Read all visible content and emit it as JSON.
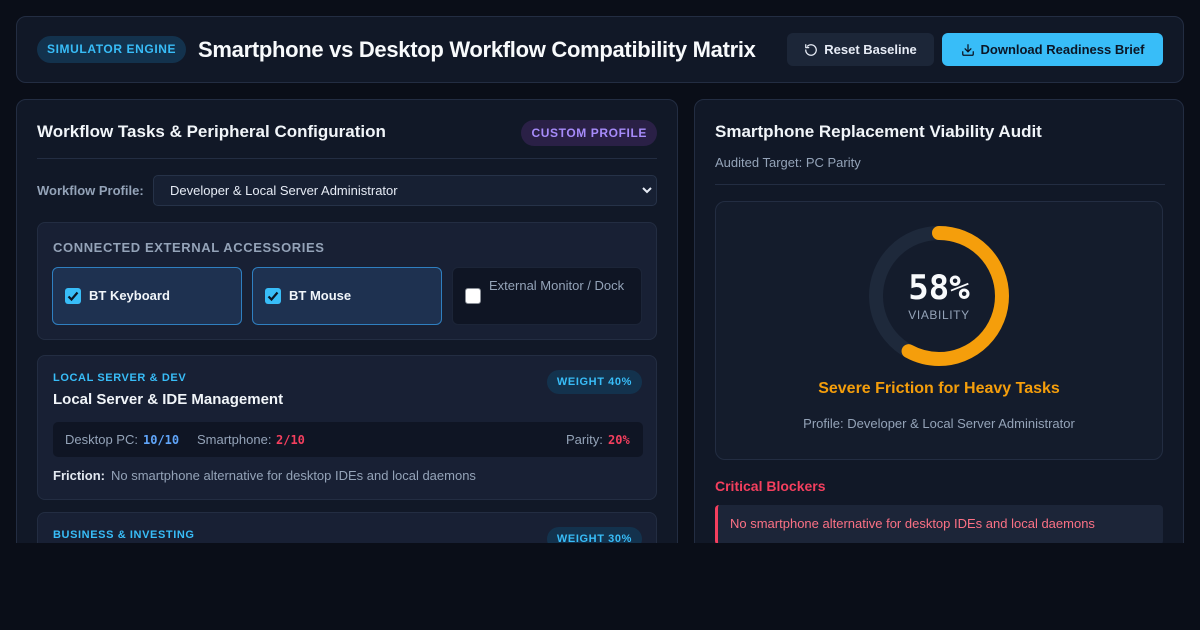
{
  "header": {
    "badge": "SIMULATOR ENGINE",
    "title": "Smartphone vs Desktop Workflow Compatibility Matrix",
    "reset_label": "Reset Baseline",
    "download_label": "Download Readiness Brief"
  },
  "left": {
    "title": "Workflow Tasks & Peripheral Configuration",
    "profile_badge": "CUSTOM PROFILE",
    "workflow_label": "Workflow Profile:",
    "workflow_value": "Developer & Local Server Administrator",
    "accessories_title": "CONNECTED EXTERNAL ACCESSORIES",
    "accessories": [
      {
        "label": "BT Keyboard",
        "checked": true
      },
      {
        "label": "BT Mouse",
        "checked": true
      },
      {
        "label": "External Monitor / Dock",
        "checked": false
      }
    ],
    "tasks": [
      {
        "category": "LOCAL SERVER & DEV",
        "weight": "WEIGHT 40%",
        "title": "Local Server & IDE Management",
        "desktop_label": "Desktop PC:",
        "desktop_score": "10/10",
        "phone_label": "Smartphone:",
        "phone_score": "2/10",
        "parity_label": "Parity:",
        "parity_value": "20%",
        "friction_label": "Friction:",
        "friction_text": "No smartphone alternative for desktop IDEs and local daemons"
      },
      {
        "category": "BUSINESS & INVESTING",
        "weight": "WEIGHT 30%"
      }
    ]
  },
  "right": {
    "title": "Smartphone Replacement Viability Audit",
    "subtitle": "Audited Target: PC Parity",
    "viability_percent": 58,
    "viability_text": "58%",
    "viability_label": "VIABILITY",
    "verdict": "Severe Friction for Heavy Tasks",
    "profile_line": "Profile: Developer & Local Server Administrator",
    "blockers_title": "Critical Blockers",
    "blockers": [
      "No smartphone alternative for desktop IDEs and local daemons"
    ]
  },
  "colors": {
    "accent": "#38bdf8",
    "warning": "#f59e0b",
    "danger": "#f43f5e",
    "purple": "#a78bfa"
  }
}
